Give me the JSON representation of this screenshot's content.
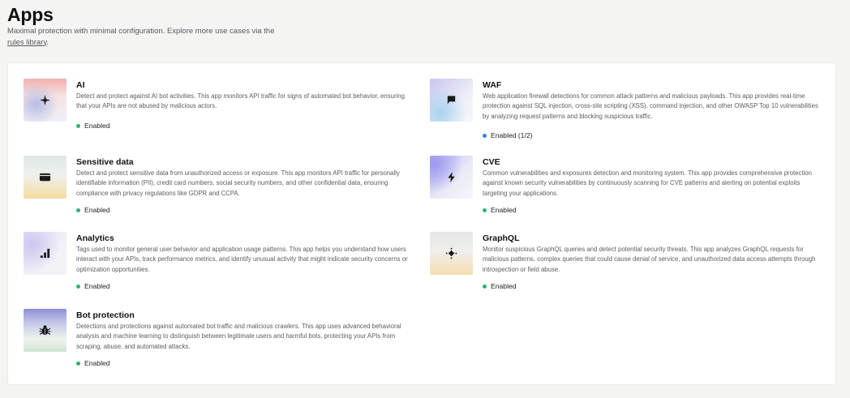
{
  "header": {
    "title": "Apps",
    "subtitle_prefix": "Maximal protection with minimal configuration. Explore more use cases via the ",
    "subtitle_link": "rules library",
    "subtitle_suffix": "."
  },
  "apps": {
    "ai": {
      "title": "AI",
      "description": "Detect and protect against AI bot activities. This app monitors API traffic for signs of automated bot behavior, ensuring that your APIs are not abused by malicious actors.",
      "status": "Enabled",
      "icon": "sparkle-icon"
    },
    "sensitive_data": {
      "title": "Sensitive data",
      "description": "Detect and protect sensitive data from unauthorized access or exposure. This app monitors API traffic for personally identifiable information (PII), credit card numbers, social security numbers, and other confidential data, ensuring compliance with privacy regulations like GDPR and CCPA.",
      "status": "Enabled",
      "icon": "credit-card-icon"
    },
    "analytics": {
      "title": "Analytics",
      "description": "Tags used to monitor general user behavior and application usage patterns. This app helps you understand how users interact with your APIs, track performance metrics, and identify unusual activity that might indicate security concerns or optimization opportunities.",
      "status": "Enabled",
      "icon": "bar-chart-icon"
    },
    "bot_protection": {
      "title": "Bot protection",
      "description": "Detections and protections against automated bot traffic and malicious crawlers. This app uses advanced behavioral analysis and machine learning to distinguish between legitimate users and harmful bots, protecting your APIs from scraping, abuse, and automated attacks.",
      "status": "Enabled",
      "icon": "bug-icon"
    },
    "waf": {
      "title": "WAF",
      "description": "Web application firewall detections for common attack patterns and malicious payloads. This app provides real-time protection against SQL injection, cross-site scripting (XSS), command injection, and other OWASP Top 10 vulnerabilities by analyzing request patterns and blocking suspicious traffic.",
      "status": "Enabled (1/2)",
      "icon": "flag-icon"
    },
    "cve": {
      "title": "CVE",
      "description": "Common vulnerabilities and exposures detection and monitoring system. This app provides comprehensive protection against known security vulnerabilities by continuously scanning for CVE patterns and alerting on potential exploits targeting your applications.",
      "status": "Enabled",
      "icon": "lightning-icon"
    },
    "graphql": {
      "title": "GraphQL",
      "description": "Monitor suspicious GraphQL queries and detect potential security threats. This app analyzes GraphQL requests for malicious patterns, complex queries that could cause denial of service, and unauthorized data access attempts through introspection or field abuse.",
      "status": "Enabled",
      "icon": "graphql-icon"
    }
  },
  "colors": {
    "enabled": "#2fb36a",
    "partial": "#3d7be6"
  }
}
